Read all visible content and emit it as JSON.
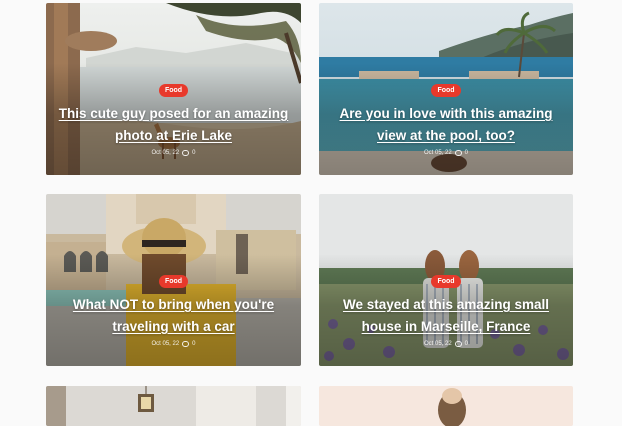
{
  "posts": [
    {
      "category": "Food",
      "title": "This cute guy posed for an amazing photo at Erie Lake",
      "date": "Oct 05, 22",
      "comments": "0"
    },
    {
      "category": "Food",
      "title": "Are you in love with this amazing view at the pool, too?",
      "date": "Oct 05, 22",
      "comments": "0"
    },
    {
      "category": "Food",
      "title": "What NOT to bring when you're traveling with a car",
      "date": "Oct 05, 22",
      "comments": "0"
    },
    {
      "category": "Food",
      "title": "We stayed at this amazing small house in Marseille, France",
      "date": "Oct 05, 22",
      "comments": "0"
    }
  ],
  "colors": {
    "badge": "#e8392b",
    "page_background": "#fafafa"
  }
}
